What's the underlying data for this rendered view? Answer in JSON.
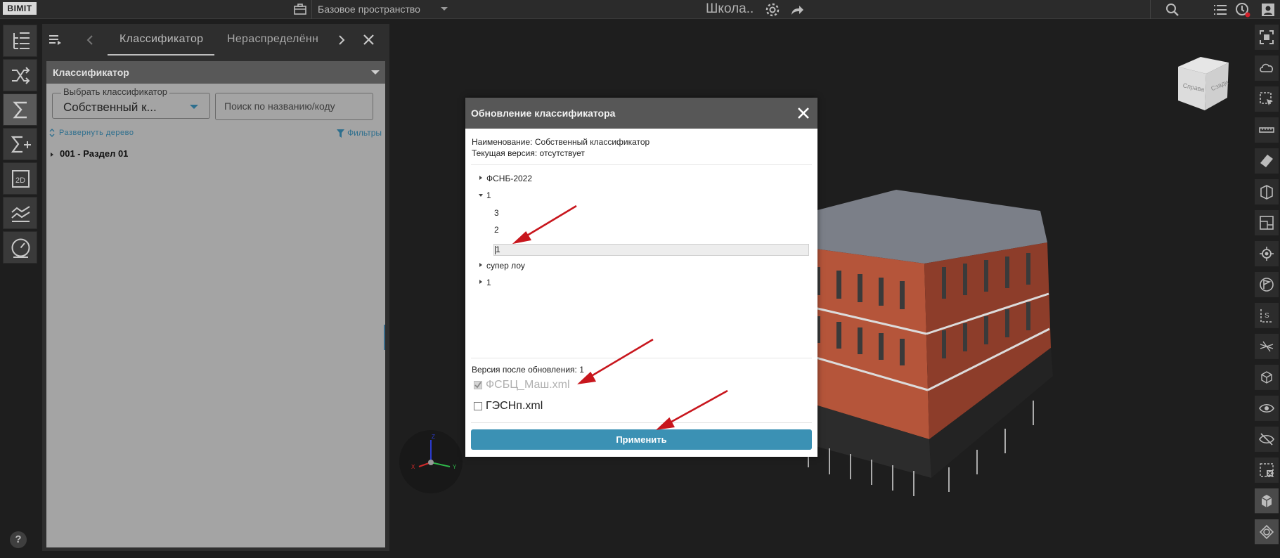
{
  "topbar": {
    "logo": "BIMIT",
    "workspace": "Базовое пространство",
    "project_title": "Школа.."
  },
  "left_panel": {
    "tabs": [
      "Классификатор",
      "Нераспределённ"
    ],
    "classifier_header": "Классификатор",
    "select_label": "Выбрать классификатор",
    "select_value": "Собственный к...",
    "search_placeholder": "Поиск по названию/коду",
    "expand_tree": "Развернуть дерево",
    "filters": "Фильтры",
    "tree_items": [
      "001 - Раздел 01"
    ]
  },
  "modal": {
    "title": "Обновление классификатора",
    "name_line": "Наименование: Собственный классификатор",
    "current_version": "Текущая версия: отсутствует",
    "tree": [
      {
        "label": "ФСНБ-2022",
        "expanded": false
      },
      {
        "label": "1",
        "expanded": true,
        "children": [
          "3",
          "2"
        ]
      },
      {
        "label": "супер лоу",
        "expanded": false
      },
      {
        "label": "1",
        "expanded": false
      }
    ],
    "new_version_value": "1",
    "version_after": "Версия после обновления: 1",
    "files": [
      {
        "label": "ФСБЦ_Маш.xml",
        "checked": true,
        "disabled": true
      },
      {
        "label": "ГЭСНп.xml",
        "checked": false,
        "disabled": false
      }
    ],
    "apply_label": "Применить"
  },
  "viewport": {
    "navcube_faces": [
      "Справа",
      "Сзади"
    ],
    "axis_labels": [
      "Z",
      "Y",
      "X"
    ]
  },
  "help_label": "?",
  "colors": {
    "accent": "#3b91b4",
    "link": "#2e6f8e",
    "arrow": "#c8161d",
    "facade": "#b5553a"
  }
}
